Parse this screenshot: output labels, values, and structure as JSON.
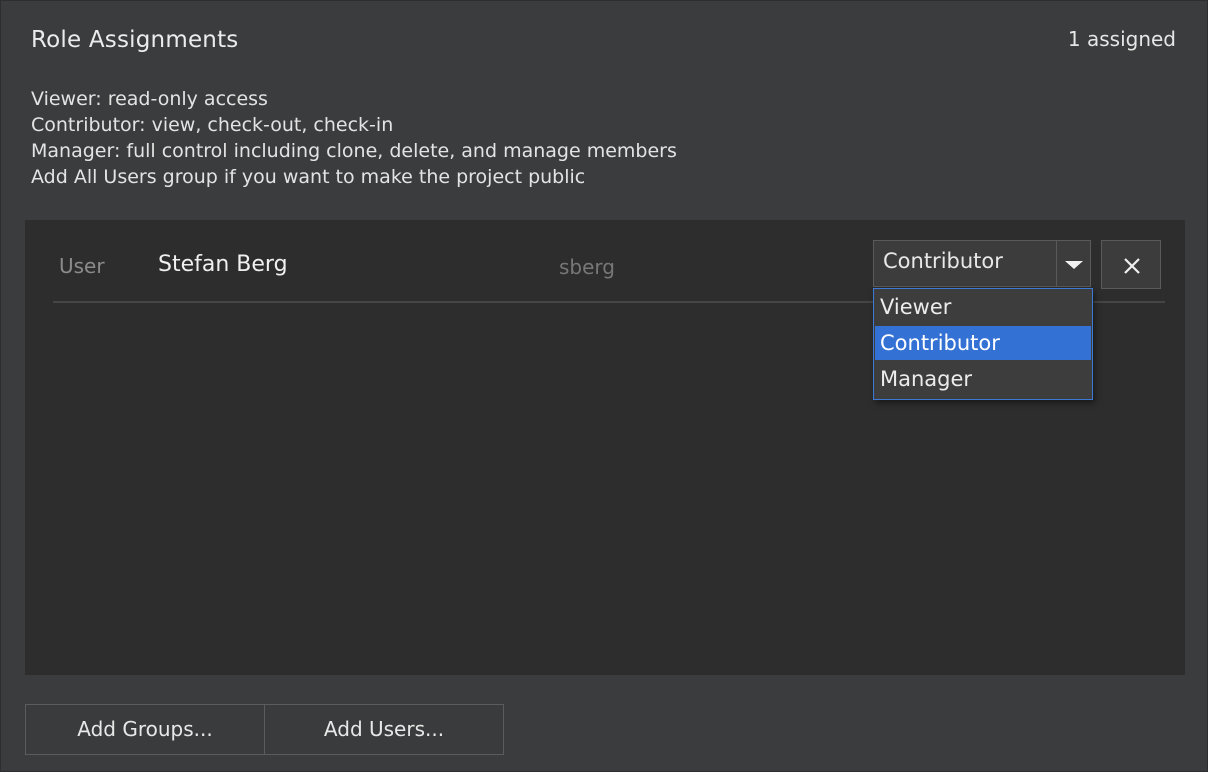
{
  "header": {
    "title": "Role Assignments",
    "count_label": "1 assigned"
  },
  "description": {
    "lines": [
      "Viewer: read-only access",
      "Contributor: view, check-out, check-in",
      "Manager: full control including clone, delete, and manage members",
      "Add All Users group if you want to make the project public"
    ]
  },
  "assignments": [
    {
      "type": "User",
      "name": "Stefan Berg",
      "login": "sberg",
      "role": "Contributor",
      "remove_icon": "close-icon"
    }
  ],
  "role_dropdown": {
    "open": true,
    "options": [
      "Viewer",
      "Contributor",
      "Manager"
    ],
    "selected": "Contributor",
    "highlight_color": "#3372d4"
  },
  "buttons": {
    "add_groups": "Add Groups...",
    "add_users": "Add Users..."
  }
}
